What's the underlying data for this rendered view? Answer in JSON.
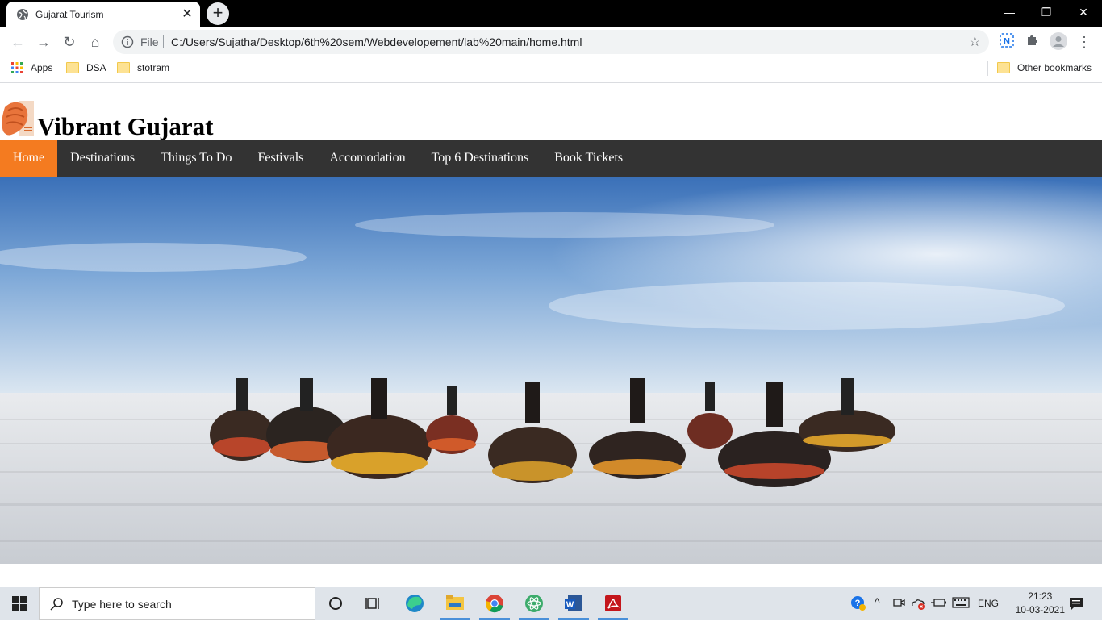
{
  "browser": {
    "tab": {
      "title": "Gujarat Tourism"
    },
    "address": {
      "scheme_label": "File",
      "url": "C:/Users/Sujatha/Desktop/6th%20sem/Webdevelopement/lab%20main/home.html"
    },
    "bookmarks": [
      {
        "label": "Apps"
      },
      {
        "label": "DSA"
      },
      {
        "label": "stotram"
      }
    ],
    "other_bookmarks": "Other bookmarks"
  },
  "site": {
    "title": "Vibrant Gujarat",
    "nav": [
      {
        "label": "Home",
        "active": true
      },
      {
        "label": "Destinations"
      },
      {
        "label": "Things To Do"
      },
      {
        "label": "Festivals"
      },
      {
        "label": "Accomodation"
      },
      {
        "label": "Top 6 Destinations"
      },
      {
        "label": "Book Tickets"
      }
    ]
  },
  "taskbar": {
    "search_placeholder": "Type here to search",
    "language": "ENG",
    "time": "21:23",
    "date": "10-03-2021"
  },
  "colors": {
    "nav_bg": "#333333",
    "nav_active": "#f47b20",
    "titlebar": "#000000"
  }
}
